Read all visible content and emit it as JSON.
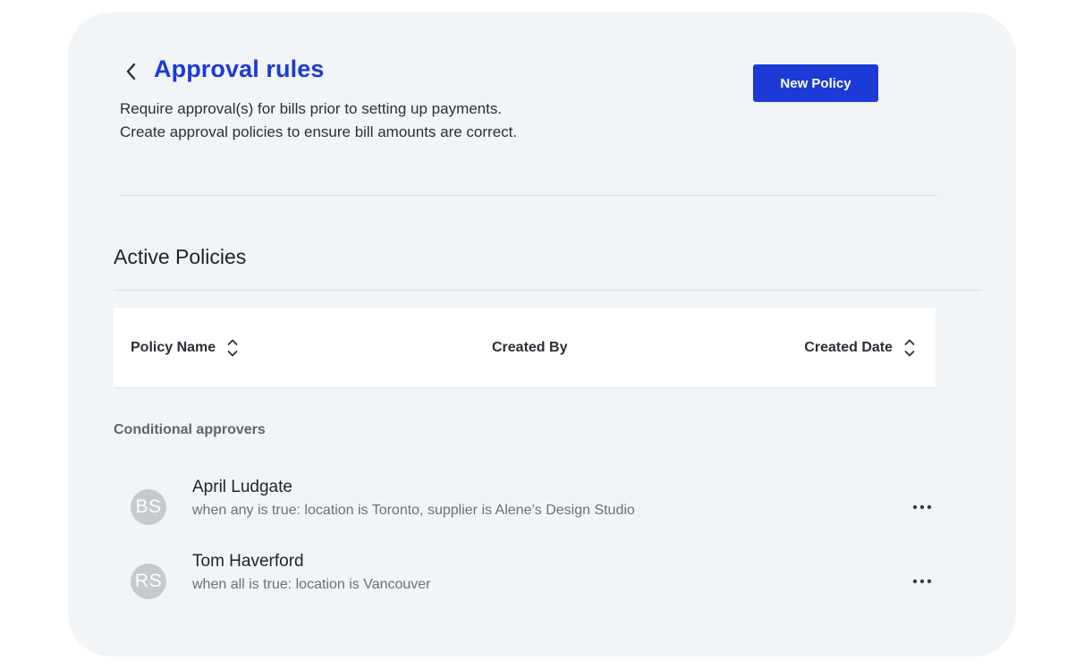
{
  "header": {
    "title": "Approval rules",
    "description_line1": "Require approval(s) for bills prior to setting up payments.",
    "description_line2": "Create approval policies to ensure bill amounts are correct.",
    "new_policy_label": "New Policy",
    "back_icon": "chevron-left-icon"
  },
  "active_policies": {
    "title": "Active Policies",
    "columns": [
      {
        "label": "Policy Name",
        "sortable": true
      },
      {
        "label": "Created By",
        "sortable": false
      },
      {
        "label": "Created Date",
        "sortable": true
      }
    ]
  },
  "conditional_approvers": {
    "label": "Conditional approvers",
    "items": [
      {
        "initials": "BS",
        "name": "April Ludgate",
        "condition": "when any is true: location is Toronto, supplier is Alene’s Design Studio"
      },
      {
        "initials": "RS",
        "name": "Tom Haverford",
        "condition": "when all is true: location is Vancouver"
      }
    ]
  },
  "colors": {
    "accent": "#1b3ad6",
    "card_background": "#f2f5f8",
    "avatar": "#c6cacf"
  }
}
